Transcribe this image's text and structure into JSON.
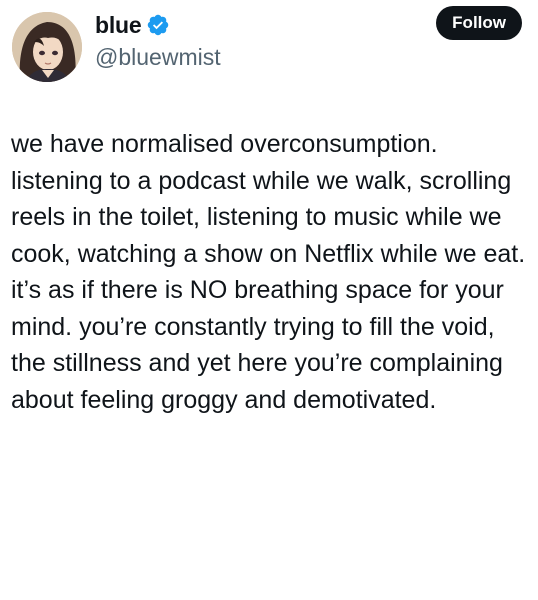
{
  "author": {
    "display_name": "blue",
    "handle": "@bluewmist",
    "verified": true
  },
  "actions": {
    "follow_label": "Follow"
  },
  "tweet": {
    "text": "we have normalised overconsumption. listening to a podcast while we walk, scrolling reels in the toilet, listening to music while we cook, watching a show on Netflix while we eat. it’s as if there is NO breathing space for your mind. you’re constantly trying to fill the void, the stillness and yet here you’re complaining about feeling groggy and demotivated."
  },
  "colors": {
    "text_primary": "#0f1419",
    "text_secondary": "#536471",
    "verified_badge": "#1d9bf0",
    "follow_button_bg": "#0f1419"
  },
  "icons": {
    "verified": "verified-badge-icon"
  }
}
